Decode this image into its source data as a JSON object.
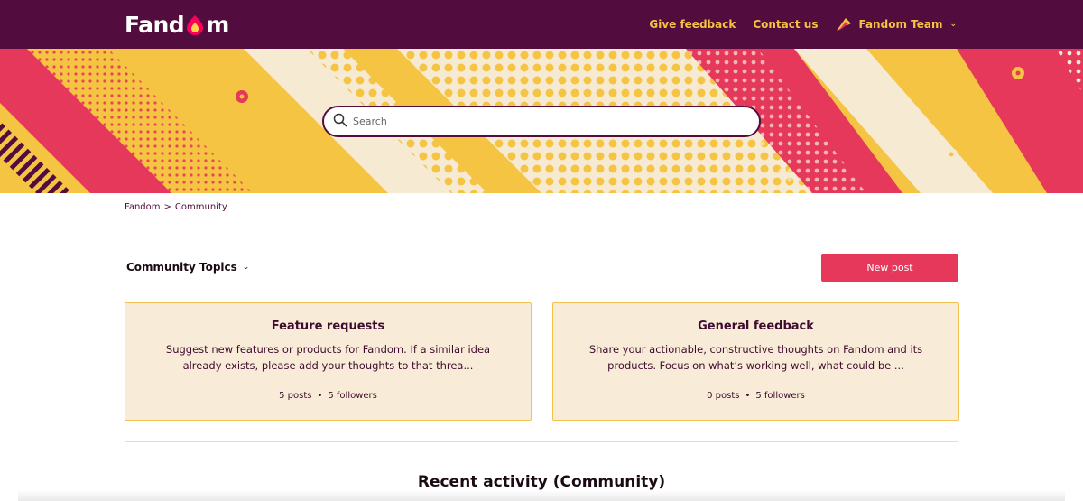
{
  "header": {
    "logo_text_left": "Fand",
    "logo_text_right": "m",
    "nav_links": [
      "Give feedback",
      "Contact us"
    ],
    "user_name": "Fandom Team"
  },
  "search": {
    "placeholder": "Search"
  },
  "breadcrumb": {
    "items": [
      "Fandom",
      "Community"
    ],
    "separator": ">"
  },
  "topics": {
    "selected": "Community Topics"
  },
  "actions": {
    "new_post_label": "New post"
  },
  "cards": [
    {
      "title": "Feature requests",
      "description": "Suggest new features or products for Fandom. If a similar idea already exists, please add your thoughts to that threa...",
      "posts": "5 posts",
      "followers": "5 followers"
    },
    {
      "title": "General feedback",
      "description": "Share your actionable, constructive thoughts on Fandom and its products. Focus on what’s working well, what could be ...",
      "posts": "0 posts",
      "followers": "5 followers"
    }
  ],
  "recent_activity": {
    "heading": "Recent activity (Community)"
  },
  "colors": {
    "header_bg": "#520d3e",
    "nav_link": "#f4c343",
    "accent_pink": "#e5385b",
    "banner_yellow": "#f6c443",
    "banner_cream": "#f7ead3",
    "card_bg": "#f8ecd9",
    "card_border": "#f2c24e"
  }
}
